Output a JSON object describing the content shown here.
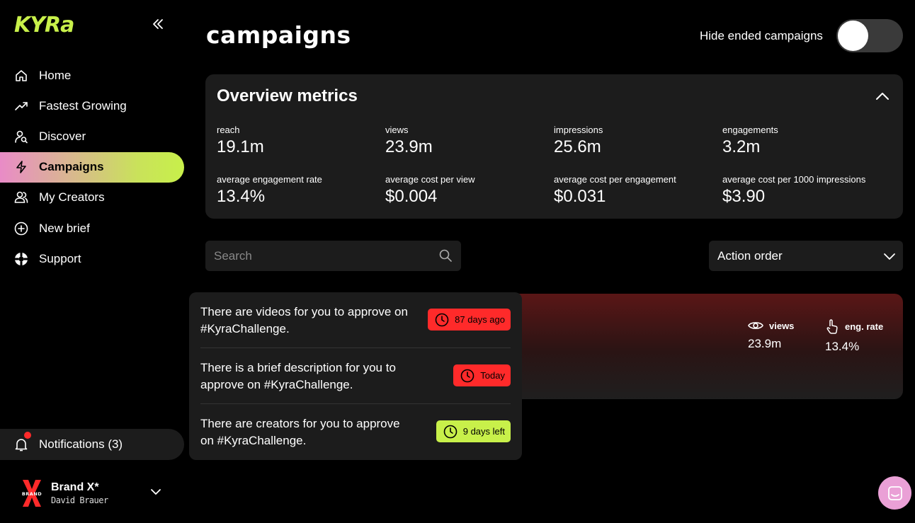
{
  "app": {
    "logo": "KYRa"
  },
  "sidebar": {
    "items": [
      {
        "label": "Home",
        "icon": "home-icon"
      },
      {
        "label": "Fastest Growing",
        "icon": "trending-icon"
      },
      {
        "label": "Discover",
        "icon": "discover-icon"
      },
      {
        "label": "Campaigns",
        "icon": "lightning-icon",
        "active": true
      },
      {
        "label": "My Creators",
        "icon": "users-icon"
      },
      {
        "label": "New brief",
        "icon": "plus-circle-icon"
      },
      {
        "label": "Support",
        "icon": "lifebuoy-icon"
      }
    ],
    "notifications_label": "Notifications (3)",
    "brand": {
      "name": "Brand X*",
      "user": "David Brauer",
      "logo_text": "BRAND",
      "logo_color": "#ff2a2a"
    }
  },
  "header": {
    "title": "campaigns",
    "hide_ended_label": "Hide ended campaigns",
    "hide_ended_on": false
  },
  "overview": {
    "title": "Overview metrics",
    "metrics": [
      {
        "label": "reach",
        "value": "19.1m"
      },
      {
        "label": "views",
        "value": "23.9m"
      },
      {
        "label": "impressions",
        "value": "25.6m"
      },
      {
        "label": "engagements",
        "value": "3.2m"
      },
      {
        "label": "average engagement rate",
        "value": "13.4%"
      },
      {
        "label": "average cost per view",
        "value": "$0.004"
      },
      {
        "label": "average cost per engagement",
        "value": "$0.031"
      },
      {
        "label": "average cost per 1000 impressions",
        "value": "$3.90"
      }
    ]
  },
  "search": {
    "placeholder": "Search",
    "value": ""
  },
  "sort": {
    "selected": "Action order"
  },
  "campaign_card": {
    "stats": [
      {
        "label": "views",
        "value": "23.9m",
        "icon": "eye-icon"
      },
      {
        "label": "eng. rate",
        "value": "13.4%",
        "icon": "tap-icon"
      }
    ]
  },
  "actions": [
    {
      "text": "There are videos for you to approve on #KyraChallenge.",
      "badge": "87 days ago",
      "status": "red"
    },
    {
      "text": "There is a brief description for you to approve on #KyraChallenge.",
      "badge": "Today",
      "status": "red"
    },
    {
      "text": "There are creators for you to approve on #KyraChallenge.",
      "badge": "9 days left",
      "status": "green"
    }
  ],
  "colors": {
    "accent_green": "#c8f04a",
    "accent_pink": "#e98bc7",
    "alert_red": "#ff2a2a",
    "panel": "#1c1c1c"
  }
}
